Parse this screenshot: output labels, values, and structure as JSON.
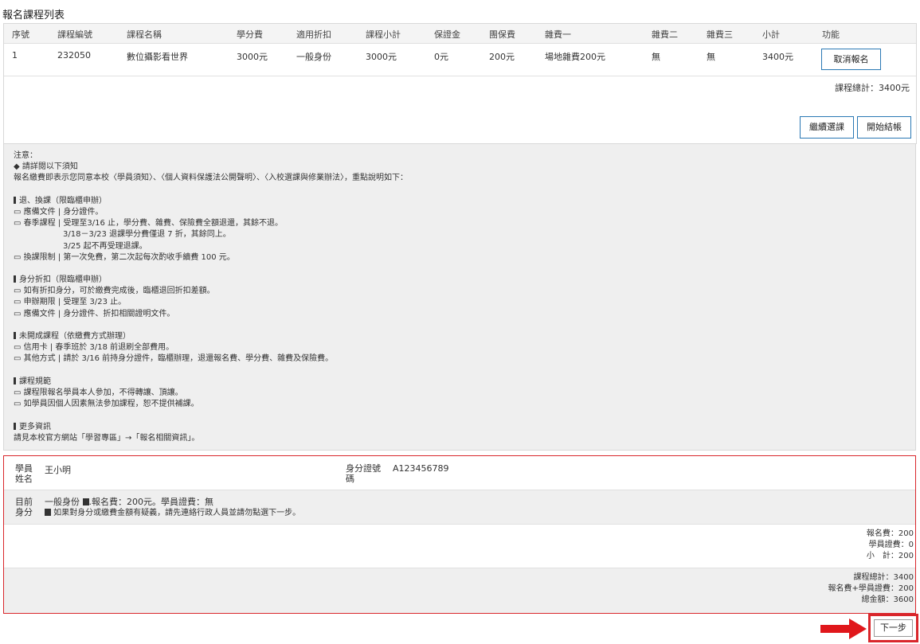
{
  "page_title": "報名課程列表",
  "table": {
    "headers": [
      "序號",
      "課程編號",
      "課程名稱",
      "學分費",
      "適用折扣",
      "課程小計",
      "保證金",
      "團保費",
      "雜費一",
      "雜費二",
      "雜費三",
      "小計",
      "功能"
    ],
    "row": [
      "1",
      "232050",
      "數位攝影看世界",
      "3000元",
      "一般身份",
      "3000元",
      "0元",
      "200元",
      "場地雜費200元",
      "無",
      "無",
      "3400元"
    ],
    "cancel_label": "取消報名"
  },
  "course_total": "課程總計：3400元",
  "buttons": {
    "continue": "繼續選課",
    "checkout": "開始結帳",
    "next": "下一步"
  },
  "notice": {
    "title": "注意：",
    "bullet": "◆ 請詳閱以下須知",
    "intro": "報名繳費即表示您同意本校〈學員須知〉、〈個人資料保護法公開聲明〉、〈入校選課與修業辦法〉，重點說明如下：",
    "s1_title": "退、換課（限臨櫃申辦）",
    "s1_l1": "▭ 應備文件 | 身分證件。",
    "s1_l2": "▭ 春季課程 | 受理至3/16 止，學分費、雜費、保險費全額退還，其餘不退。",
    "s1_l3": "3/18－3/23 退課學分費僅退 7 折，其餘同上。",
    "s1_l4": "3/25 起不再受理退課。",
    "s1_l5": "▭ 換課限制 | 第一次免費，第二次起每次酌收手續費 100 元。",
    "s2_title": "身分折扣（限臨櫃申辦）",
    "s2_l1": "▭ 如有折扣身分，可於繳費完成後，臨櫃退回折扣差額。",
    "s2_l2": "▭ 申辦期限 | 受理至 3/23 止。",
    "s2_l3": "▭ 應備文件 | 身分證件、折扣相關證明文件。",
    "s3_title": "未開成課程（依繳費方式辦理）",
    "s3_l1": "▭ 信用卡 | 春季班於 3/18 前退刷全部費用。",
    "s3_l2": "▭ 其他方式 | 請於 3/16 前持身分證件，臨櫃辦理，退還報名費、學分費、雜費及保險費。",
    "s4_title": "課程規範",
    "s4_l1": "▭ 課程限報名學員本人參加，不得轉讓、頂讓。",
    "s4_l2": "▭ 如學員因個人因素無法參加課程，恕不提供補課。",
    "s5_title": "更多資訊",
    "s5_l1": "請見本校官方網站「學習專區」→「報名相關資訊」。"
  },
  "student": {
    "name_label_1": "學員",
    "name_label_2": "姓名",
    "name": "王小明",
    "id_label_1": "身分證號",
    "id_label_2": "碼",
    "id": "A123456789",
    "identity_label_1": "目前",
    "identity_label_2": "身分",
    "identity_line1": "一般身份 ",
    "identity_line1b": ".報名費：200元。學員證費：無",
    "identity_line2": " 如果對身分或繳費金額有疑義，請先連絡行政人員並請勿點選下一步。",
    "fee1": "報名費：200",
    "fee2": "學員證費：0",
    "fee3": "小　計：200",
    "sum1": "課程總計：3400",
    "sum2": "報名費+學員證費：200",
    "sum3": "總金額：3600"
  },
  "colors": {
    "accent_border": "#2a78b4",
    "highlight": "#d9262b"
  }
}
